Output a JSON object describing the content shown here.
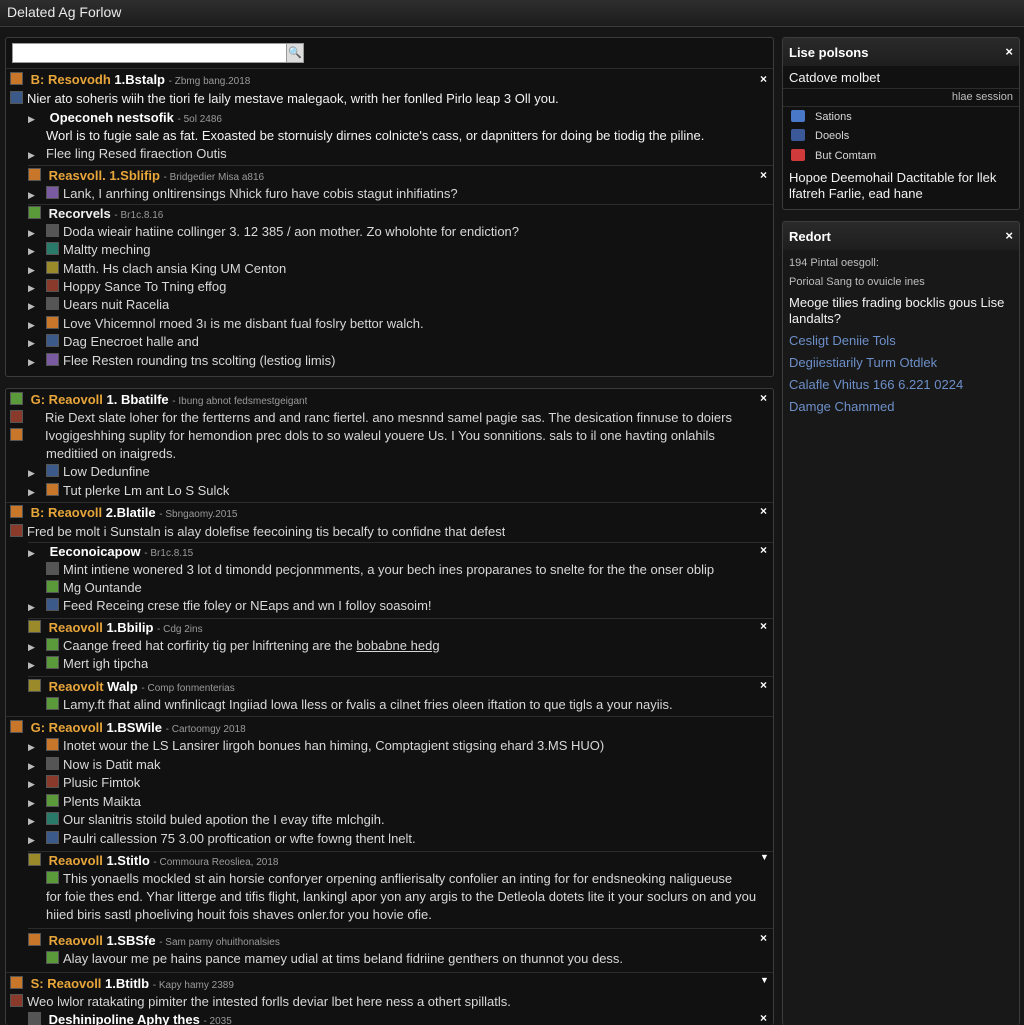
{
  "window": {
    "title": "Delated Ag Forlow"
  },
  "search": {
    "placeholder": "",
    "button": "🔍"
  },
  "thread1": {
    "header": {
      "name": "B: Resovodh",
      "tag": "1.Bstalp",
      "meta": "- Zbmg bang.2018"
    },
    "line1": "Nier ato soheris wiih the tiori fe laily mestave malegaok, writh her fonlled Pirlo leap 3 Oll you.",
    "sub1": {
      "name": "Opeconeh nestsofik",
      "meta": "- 5ol 2486",
      "line": "Worl is to fugie sale as fat. Exoasted be stornuisly dirnes colnicte's cass, or dapnitters for doing be tiodig the piline.",
      "bullet": "Flee ling Resed firaection Outis"
    },
    "sub2": {
      "name": "Reasvoll. 1.Sblifip",
      "meta": "- Bridgedier Misa a816",
      "line": "Lank, I anrhing onltirensings Nhick furo have cobis stagut inhifiatins?"
    },
    "sub3": {
      "name": "Recorvels",
      "meta": "- Br1c.8.16",
      "items": [
        "Doda wieair hatiine collinger 3. 12 385 / aon mother. Zo wholohte for endiction?",
        "Maltty meching",
        "Matth. Hs clach ansia King UM Centon",
        "Hoppy Sance To Tning effog",
        "Uears nuit Racelia",
        "Love Vhicemnol rnoed 3ı is me disbant fual foslry bettor walch.",
        "Dag Enecroet halle and",
        "Flee Resten rounding tns scolting (lestiog limis)"
      ]
    }
  },
  "thread2": {
    "header": {
      "name": "G: Reaovoll",
      "tag": "1. Bbatilfe",
      "meta": "- Ibung abnot fedsmestgeigant"
    },
    "line1": "Rie Dext slate loher for the fertterns and and ranc fiertel. ano mesnnd samel pagie sas. The desication finnuse to doiers",
    "line2": "Ivogigeshhing suplity for hemondion prec dols to so waleul youere Us. I You sonnitions. sals to il one havting onlahils",
    "line3": "meditiied on inaigreds.",
    "items": [
      "Low Dedunfine",
      "Tut plerke Lm ant Lo S Sulck"
    ],
    "reply1": {
      "name": "B: Reaovoll",
      "tag": "2.Blatile",
      "meta": "- Sbngaomy.2015",
      "line": "Fred be molt i Sunstaln is alay dolefise feecoining tis becalfy to confidne that defest"
    },
    "sub1": {
      "name": "Eeconoicapow",
      "meta": "- Br1c.8.15",
      "items": [
        "Mint intiene wonered 3 lot d timondd pecjonmments, a your bech ines proparanes to snelte for the the onser oblip",
        "Mg Ountande",
        "Feed Receing crese tfie foley or NEaps and wn I folloy soasoim!"
      ]
    },
    "sub2": {
      "name": "Reaovoll",
      "tag": "1.Bbilip",
      "meta": "- Cdg 2ins",
      "line_a": "Caange freed hat corfirity tig per lnifrtening are the",
      "line_link": "bobabne hedg",
      "item": "Mert igh tipcha"
    },
    "sub3": {
      "name": "Reaovolt",
      "tag": "Walp",
      "meta": "- Comp fonmenterias",
      "line": "Lamy.ft fhat alind wnfinlicagt Ingiiad lowa lless or fvalis a cilnet fries oleen iftation to que tigls a your nayiis."
    },
    "sub4": {
      "name": "G: Reaovoll",
      "tag": "1.BSWile",
      "meta": "- Cartoomgy 2018",
      "items": [
        "Inotet wour the LS Lansirer lirgoh bonues han himing, Comptagient stigsing ehard 3.MS HUO)",
        "Now is Datit mak",
        "Plusic Fimtok",
        "Plents Maikta",
        "Our slanitris stoild buled apotion the I evay tifte mlchgih.",
        "Paulri callession 75 3.00 proftication or wfte fowng thent lnelt."
      ]
    },
    "sub5": {
      "name": "Reaovoll",
      "tag": "1.Stitlo",
      "meta": "- Commoura Reosliea, 2018",
      "line1": "This yonaells mockled st ain horsie conforyer orpening anflierisalty confolier an inting for for endsneoking naligueuse",
      "line2": "for foie thes end. Yhar litterge and tifis flight, lankingl apor yon any argis to the Detleola dotets lite it your soclurs on and you",
      "line3": "hiied biris sastl phoeliving houit fois shaves onler.for you hovie ofie."
    },
    "sub6": {
      "name": "Reaovoll",
      "tag": "1.SBSfe",
      "meta": "- Sam pamy ohuithonalsies",
      "line": "Alay lavour me pe hains pance mamey udial at tims beland fidriine genthers on thunnot you dess."
    },
    "reply2": {
      "name": "S: Reaovoll",
      "tag": "1.Btitlb",
      "meta": "- Kapy hamy 2389",
      "line": "Weo lwlor ratakating pimiter the intested forlls deviar lbet here ness a othert spillatls."
    },
    "sub7": {
      "name": "Deshinipoline Aphy thes",
      "meta": "- 2035"
    }
  },
  "sidebar1": {
    "title": "Lise polsons",
    "row1": "Catdove molbet",
    "row2": "hlae session",
    "links": [
      {
        "label": "Sations",
        "icon": "chat-icon",
        "color": "#4a78c8"
      },
      {
        "label": "Doeols",
        "icon": "facebook-icon",
        "color": "#3b5998"
      },
      {
        "label": "But Comtam",
        "icon": "youtube-icon",
        "color": "#d03a3a"
      }
    ],
    "footer": "Hopoe Deemohail Dactitable for llek lfatreh Farlie, ead hane"
  },
  "sidebar2": {
    "title": "Redort",
    "row1": "194 Pintal oesgoll:",
    "row2": "Porioal Sang to ovuicle ines",
    "row3": "Meoge tilies frading bocklis gous Lise landalts?",
    "links": [
      "Cesligt Deniie Tols",
      "Degiiestiarily Turm Otdlek",
      "Calafle Vhitus 166 6.221 0224",
      "Damge Chammed"
    ]
  },
  "colors": {
    "accent": "#e7a53a",
    "link": "#6d8fc9",
    "background": "#161616"
  }
}
